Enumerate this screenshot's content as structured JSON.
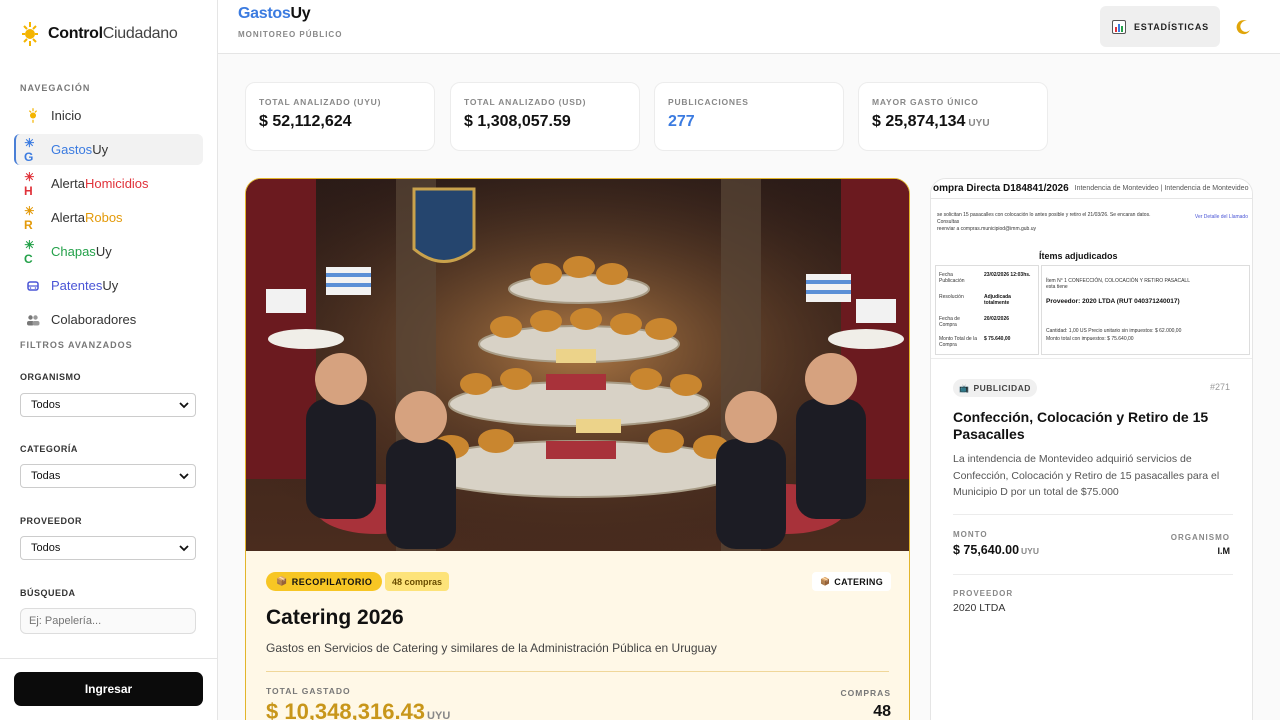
{
  "sidebar": {
    "brand_bold": "Control",
    "brand_light": "Ciudadano",
    "nav_title": "NAVEGACIÓN",
    "items": [
      {
        "label_a": "Inicio",
        "label_b": ""
      },
      {
        "label_a": "Gastos",
        "label_b": "Uy"
      },
      {
        "label_a": "Alerta",
        "label_b": "Homicidios"
      },
      {
        "label_a": "Alerta",
        "label_b": "Robos"
      },
      {
        "label_a": "Chapas",
        "label_b": "Uy"
      },
      {
        "label_a": "Patentes",
        "label_b": "Uy"
      },
      {
        "label_a": "Colaboradores",
        "label_b": ""
      }
    ],
    "filters_title": "FILTROS AVANZADOS",
    "filters": {
      "organismo_label": "ORGANISMO",
      "organismo_value": "Todos",
      "categoria_label": "CATEGORÍA",
      "categoria_value": "Todas",
      "proveedor_label": "PROVEEDOR",
      "proveedor_value": "Todos",
      "busqueda_label": "BÚSQUEDA",
      "busqueda_placeholder": "Ej: Papelería..."
    },
    "login_label": "Ingresar"
  },
  "header": {
    "title_a": "Gastos",
    "title_b": "Uy",
    "subtitle": "MONITOREO PÚBLICO",
    "stats_label": "ESTADÍSTICAS"
  },
  "stats": [
    {
      "label": "TOTAL ANALIZADO (UYU)",
      "value": "$ 52,112,624",
      "unit": ""
    },
    {
      "label": "TOTAL ANALIZADO (USD)",
      "value": "$ 1,308,057.59",
      "unit": ""
    },
    {
      "label": "PUBLICACIONES",
      "value": "277",
      "unit": ""
    },
    {
      "label": "MAYOR GASTO ÚNICO",
      "value": "$ 25,874,134",
      "unit": "UYU"
    }
  ],
  "main_card": {
    "badge": "RECOPILATORIO",
    "count_badge": "48 compras",
    "category": "CATERING",
    "title": "Catering 2026",
    "description": "Gastos en Servicios de Catering y similares de la Administración Pública en Uruguay",
    "total_label": "TOTAL GASTADO",
    "total_value": "$ 10,348,316.43",
    "total_unit": "UYU",
    "count_label": "COMPRAS",
    "count_value": "48"
  },
  "side_card": {
    "doc": {
      "title": "ompra Directa D184841/2026",
      "subtitle": "Intendencia de Montevideo | Intendencia de Montevideo",
      "note": "se solicitan 15 pasacalles con colocación lo antes posible y retiro el 21/03/26. Se encaran datos. Consultas",
      "note2": "reenviar a compras.municipiod@imm.gub.uy",
      "link": "Ver Detalle del Llamado",
      "section": "Ítems adjudicados",
      "rows": [
        {
          "k": "Fecha Publicación",
          "v": "23/02/2026 12:03hs."
        },
        {
          "k": "Resolución",
          "v": "Adjudicada totalmente"
        },
        {
          "k": "Fecha de Compra",
          "v": "20/02/2026"
        },
        {
          "k": "Monto Total de la Compra",
          "v": "$ 75.640,00"
        }
      ],
      "item": "Ítem N° 1  CONFECCIÓN, COLOCACIÓN Y RETIRO PASACALL esta tiene",
      "provider_line": "Proveedor: 2020 LTDA (RUT 040371240017)",
      "qty_line": "Cantidad: 1,00 US   Precio unitario sin impuestos: $ 62.000,00",
      "total_line": "Monto total con impuestos: $ 75.640,00"
    },
    "badge": "PUBLICIDAD",
    "number": "#271",
    "title": "Confección, Colocación y Retiro de 15 Pasacalles",
    "description": "La intendencia de Montevideo adquirió servicios de Confección, Colocación y Retiro de 15 pasacalles para el Municipio D por un total de $75.000",
    "monto_label": "MONTO",
    "monto_value": "$ 75,640.00",
    "monto_unit": "UYU",
    "org_label": "ORGANISMO",
    "org_value": "I.M",
    "prov_label": "PROVEEDOR",
    "prov_value": "2020 LTDA"
  },
  "colors": {
    "accent_blue": "#3b7be0",
    "gold": "#c8961a",
    "badge_yellow": "#f7c624",
    "red": "#e0323a",
    "orange": "#e39a0a",
    "green": "#24a14a",
    "indigo": "#4a55d6"
  },
  "icons": [
    "sun-flag-icon",
    "gastos-icon",
    "homicidios-icon",
    "robos-icon",
    "chapas-icon",
    "car-icon",
    "people-icon",
    "chevron-down-icon",
    "chart-icon",
    "moon-icon",
    "package-icon",
    "tv-icon"
  ]
}
